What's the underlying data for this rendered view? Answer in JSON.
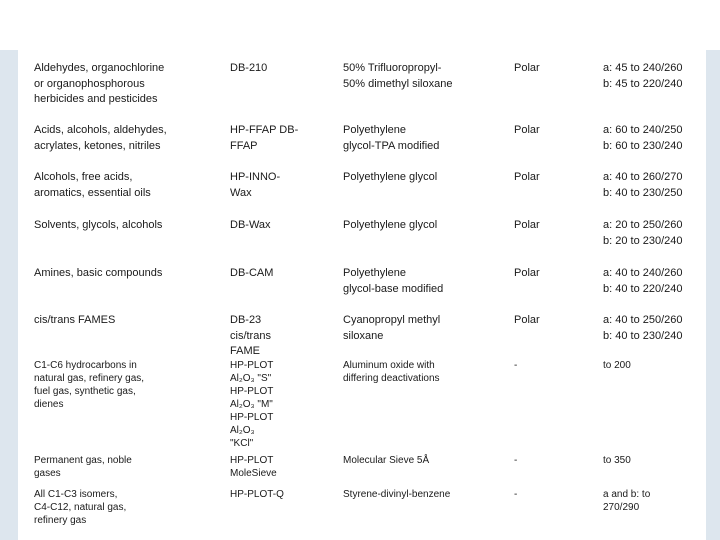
{
  "rows": [
    {
      "compound": [
        "Aldehydes, organochlorine",
        "or organophosphorous",
        "herbicides and pesticides"
      ],
      "column": [
        "DB-210"
      ],
      "phase": [
        "50% Trifluoropropyl-",
        "50% dimethyl siloxane"
      ],
      "polarity": "Polar",
      "temps": [
        "a: 45 to 240/260",
        "b: 45 to 220/240"
      ]
    },
    {
      "compound": [
        "Acids, alcohols, aldehydes,",
        "acrylates, ketones, nitriles"
      ],
      "column": [
        "HP-FFAP DB-",
        "FFAP"
      ],
      "phase": [
        "Polyethylene",
        "glycol-TPA modified"
      ],
      "polarity": "Polar",
      "temps": [
        "a: 60 to 240/250",
        "b: 60 to 230/240"
      ]
    },
    {
      "compound": [
        "Alcohols, free acids,",
        "aromatics, essential oils"
      ],
      "column": [
        "HP-INNO-",
        "Wax"
      ],
      "phase": [
        "Polyethylene glycol"
      ],
      "polarity": "Polar",
      "temps": [
        "a: 40 to 260/270",
        "b: 40 to 230/250"
      ]
    },
    {
      "compound": [
        "Solvents, glycols, alcohols"
      ],
      "column": [
        "DB-Wax"
      ],
      "phase": [
        "Polyethylene glycol"
      ],
      "polarity": "Polar",
      "temps": [
        "a: 20 to 250/260",
        "b: 20 to 230/240"
      ]
    },
    {
      "compound": [
        "Amines, basic compounds"
      ],
      "column": [
        "DB-CAM"
      ],
      "phase": [
        "Polyethylene",
        "glycol-base modified"
      ],
      "polarity": "Polar",
      "temps": [
        "a: 40 to 240/260",
        "b: 40 to 220/240"
      ]
    },
    {
      "compound": [
        "cis/trans FAMES"
      ],
      "column": [
        "DB-23",
        "cis/trans",
        "FAME"
      ],
      "phase": [
        "Cyanopropyl methyl",
        "siloxane"
      ],
      "polarity": "Polar",
      "temps": [
        "a: 40 to 250/260",
        "b: 40 to 230/240"
      ]
    },
    {
      "compound": [
        "C1-C6 hydrocarbons in",
        "natural gas, refinery gas,",
        "fuel gas, synthetic gas,",
        "dienes"
      ],
      "column": [
        "HP-PLOT",
        "Al₂O₃ \"S\"",
        "HP-PLOT",
        "Al₂O₃ \"M\"",
        "HP-PLOT",
        "Al₂O₃",
        "\"KCl\""
      ],
      "phase": [
        "Aluminum oxide with",
        "differing deactivations"
      ],
      "polarity": "-",
      "temps": [
        "to 200"
      ]
    },
    {
      "compound": [
        "Permanent gas, noble",
        "gases"
      ],
      "column": [
        "HP-PLOT",
        "MoleSieve"
      ],
      "phase": [
        "Molecular Sieve 5Å"
      ],
      "polarity": "-",
      "temps": [
        "to 350"
      ]
    },
    {
      "compound": [
        "All C1-C3 isomers,",
        "C4-C12, natural gas,",
        "refinery gas"
      ],
      "column": [
        "HP-PLOT-Q"
      ],
      "phase": [
        "Styrene-divinyl-benzene"
      ],
      "polarity": "-",
      "temps": [
        "a and b: to",
        "270/290"
      ]
    }
  ]
}
